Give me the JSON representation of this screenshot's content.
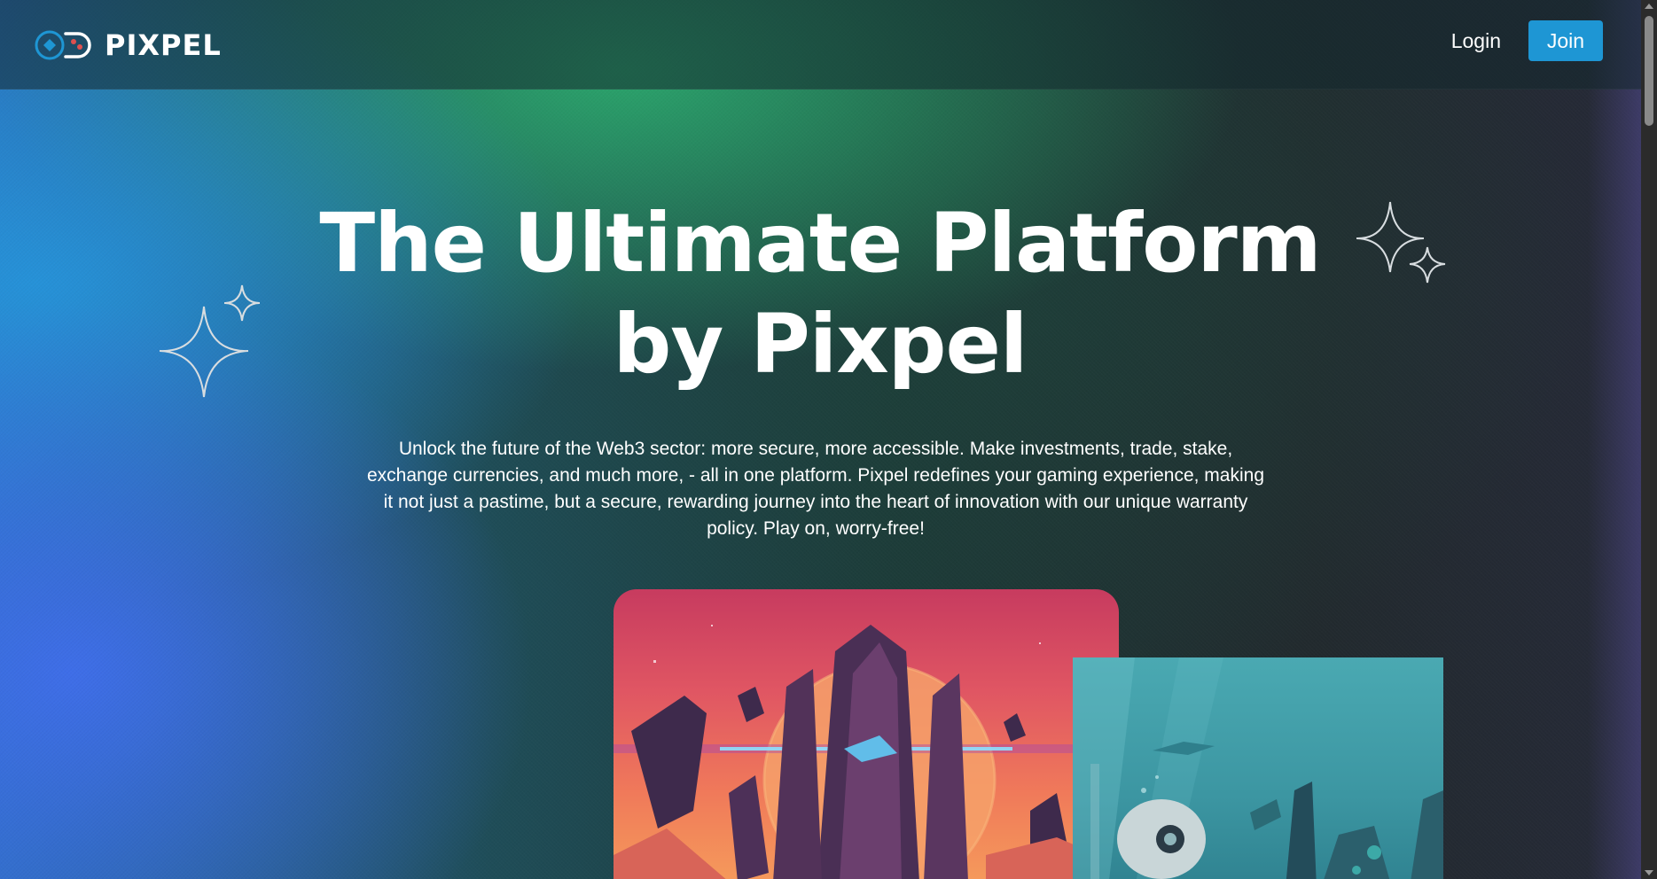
{
  "brand": {
    "name": "PIXPEL"
  },
  "nav": {
    "login_label": "Login",
    "join_label": "Join"
  },
  "hero": {
    "title": "The Ultimate Platform by Pixpel",
    "description": "Unlock the future of the Web3 sector: more secure, more accessible. Make investments, trade, stake, exchange currencies, and much more, - all in one platform. Pixpel redefines your gaming experience, making it not just a pastime, but a secure, rewarding journey into the heart of innovation with our unique warranty policy. Play on, worry-free!"
  },
  "colors": {
    "accent": "#1e96d4",
    "card_red": "#e05663",
    "card_teal": "#4aa9b2"
  },
  "icons": {
    "logo": "gamepad-logo-icon",
    "sparkle": "sparkle-icon"
  }
}
